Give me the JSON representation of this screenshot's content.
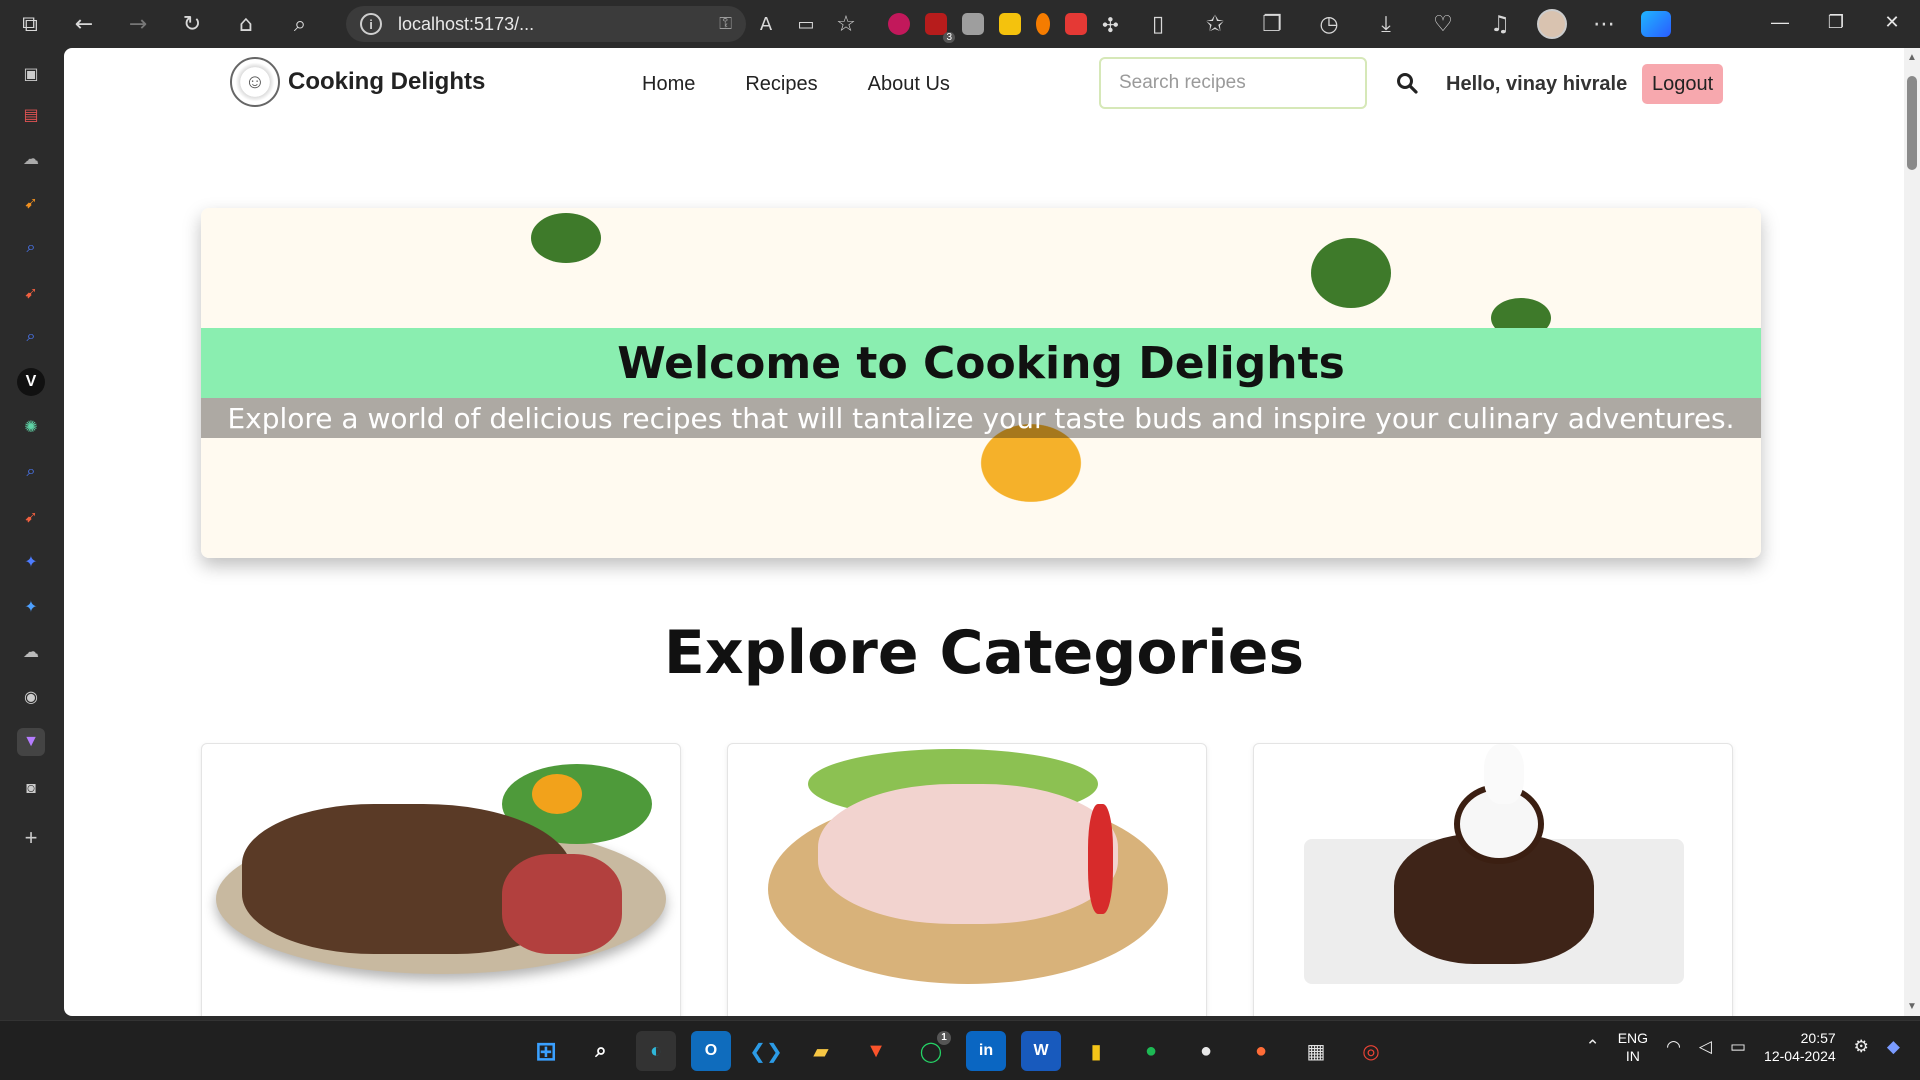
{
  "browser": {
    "address": "localhost:5173/...",
    "nav_icons": [
      "tabs-icon",
      "back-icon",
      "forward-icon",
      "refresh-icon",
      "home-icon",
      "search-icon"
    ]
  },
  "site": {
    "brand": "Cooking Delights",
    "nav": [
      "Home",
      "Recipes",
      "About Us"
    ],
    "search_placeholder": "Search recipes",
    "greeting": "Hello, vinay hivrale",
    "logout": "Logout"
  },
  "hero": {
    "title": "Welcome to Cooking Delights",
    "subtitle": "Explore a world of delicious recipes that will tantalize your taste buds and inspire your culinary adventures."
  },
  "categories": {
    "heading": "Explore Categories",
    "cards": [
      {
        "image": "steak"
      },
      {
        "image": "chicken"
      },
      {
        "image": "dessert"
      }
    ]
  },
  "taskbar": {
    "lang_top": "ENG",
    "lang_bottom": "IN",
    "time": "20:57",
    "date": "12-04-2024",
    "whatsapp_badge": "1"
  },
  "extensions": {
    "ublock_badge": "3"
  },
  "colors": {
    "hero_band": "#8aeeb0",
    "logout_bg": "#f7a8ae",
    "search_border": "#d6e8b8"
  }
}
